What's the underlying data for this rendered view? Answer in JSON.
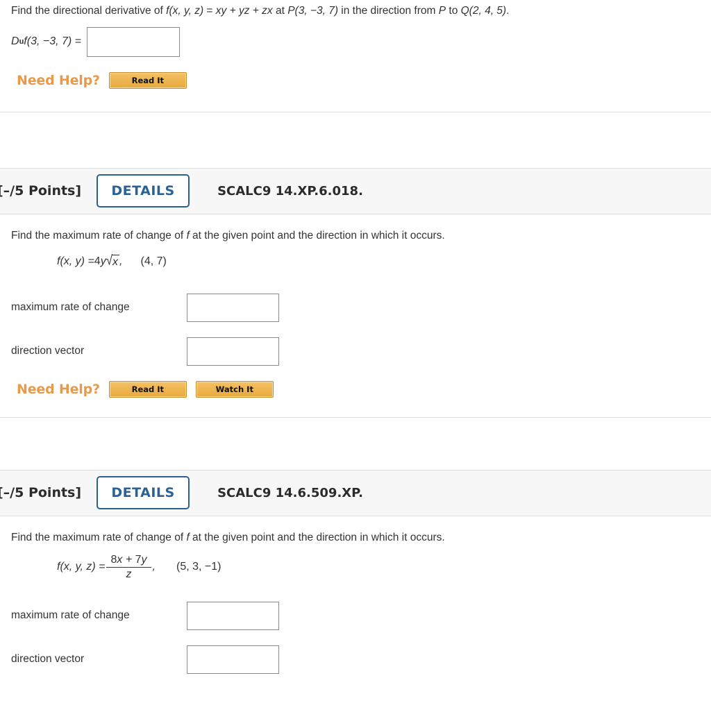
{
  "page": {
    "background": "#ffffff",
    "accent_blue": "#2a6196",
    "help_orange": "#E89A4A",
    "divider": "#dddddd"
  },
  "questions": [
    {
      "id": "q-top-partial",
      "prompt_parts": {
        "lead": "Find the directional derivative of ",
        "fn": "f(x, y, z)",
        "eq": " = ",
        "expr": "xy + yz + zx",
        "at": " at ",
        "point_p": "P(3, −3, 7)",
        "mid": " in the direction from ",
        "p": "P",
        "to": " to ",
        "point_q": "Q(2, 4, 5)",
        "end": "."
      },
      "answer_line": {
        "label_d": "D",
        "label_sub": "u",
        "label_f": "f(3, −3, 7) =",
        "input_value": "",
        "input_placeholder": ""
      },
      "need_help": {
        "label": "Need Help?",
        "buttons": [
          "Read It"
        ]
      }
    },
    {
      "id": "q-scalc9-14xp6018",
      "header": {
        "points": "[–/5 Points]",
        "details_label": "DETAILS",
        "question_code": "SCALC9 14.XP.6.018."
      },
      "prompt": "Find the maximum rate of change of f at the given point and the direction in which it occurs.",
      "prompt_italic_token": "f",
      "function_line": {
        "lhs": "f(x, y) = ",
        "coefficient": "4y",
        "sqrt_radicand": "x",
        "comma": ",",
        "point": "(4, 7)"
      },
      "fields": [
        {
          "label": "maximum rate of change",
          "value": "",
          "placeholder": ""
        },
        {
          "label": "direction vector",
          "value": "",
          "placeholder": ""
        }
      ],
      "need_help": {
        "label": "Need Help?",
        "buttons": [
          "Read It",
          "Watch It"
        ]
      }
    },
    {
      "id": "q-scalc9-146509xp",
      "header": {
        "points": "[–/5 Points]",
        "details_label": "DETAILS",
        "question_code": "SCALC9 14.6.509.XP."
      },
      "prompt": "Find the maximum rate of change of f at the given point and the direction in which it occurs.",
      "function_line": {
        "lhs": "f(x, y, z) = ",
        "numerator": "8x + 7y",
        "denominator": "z",
        "comma": ",",
        "point": "(5, 3, −1)"
      },
      "fields": [
        {
          "label": "maximum rate of change",
          "value": "",
          "placeholder": ""
        },
        {
          "label": "direction vector",
          "value": "",
          "placeholder": ""
        }
      ]
    }
  ]
}
